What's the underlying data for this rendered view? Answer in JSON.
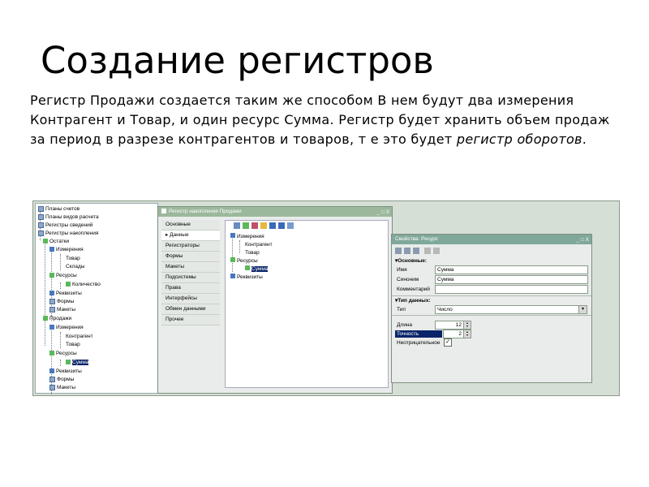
{
  "slide": {
    "title": "Создание регистров",
    "body_plain": "Регистр Продажи создается таким же способом В нем будут два измерения Контрагент и Товар, и один ресурс Сумма. Регистр будет хранить объем продаж за период в разрезе контрагентов и товаров, т е это будет ",
    "body_italic": "регистр оборотов",
    "body_end": "."
  },
  "tree": {
    "items": [
      {
        "label": "Планы счетов"
      },
      {
        "label": "Планы видов расчета"
      },
      {
        "label": "Регистры сведений"
      },
      {
        "label": "Регистры накопления"
      },
      {
        "label": "Остатки"
      },
      {
        "label": "Измерения"
      },
      {
        "label": "Товар"
      },
      {
        "label": "Склады"
      },
      {
        "label": "Ресурсы"
      },
      {
        "label": "Количество"
      },
      {
        "label": "Реквизиты"
      },
      {
        "label": "Формы"
      },
      {
        "label": "Макеты"
      },
      {
        "label": "Продажи"
      },
      {
        "label": "Измерения"
      },
      {
        "label": "Контрагент"
      },
      {
        "label": "Товар"
      },
      {
        "label": "Ресурсы"
      },
      {
        "label": "Сумма"
      },
      {
        "label": "Реквизиты"
      },
      {
        "label": "Формы"
      },
      {
        "label": "Макеты"
      }
    ]
  },
  "register_window": {
    "title": "Регистр накопления Продажи",
    "window_buttons": "_ □ X",
    "tabs": [
      {
        "label": "Основные"
      },
      {
        "label": "Данные"
      },
      {
        "label": "Регистраторы"
      },
      {
        "label": "Формы"
      },
      {
        "label": "Макеты"
      },
      {
        "label": "Подсистемы"
      },
      {
        "label": "Права"
      },
      {
        "label": "Интерфейсы"
      },
      {
        "label": "Обмен данными"
      },
      {
        "label": "Прочее"
      }
    ],
    "tree": [
      {
        "label": "Измерения"
      },
      {
        "label": "Контрагент"
      },
      {
        "label": "Товар"
      },
      {
        "label": "Ресурсы"
      },
      {
        "label": "Сумма"
      },
      {
        "label": "Реквизиты"
      }
    ]
  },
  "props_window": {
    "title": "Свойства: Ресурс",
    "window_buttons": "_ □ X",
    "section_main": "Основные:",
    "name_label": "Имя",
    "name_value": "Сумма",
    "synonym_label": "Синоним",
    "synonym_value": "Сумма",
    "comment_label": "Комментарий",
    "comment_value": "",
    "section_type": "Тип данных:",
    "type_label": "Тип",
    "type_value": "Число",
    "length_label": "Длина",
    "length_value": "12",
    "precision_label": "Точность",
    "precision_value": "2",
    "nonneg_label": "Неотрицательное"
  }
}
